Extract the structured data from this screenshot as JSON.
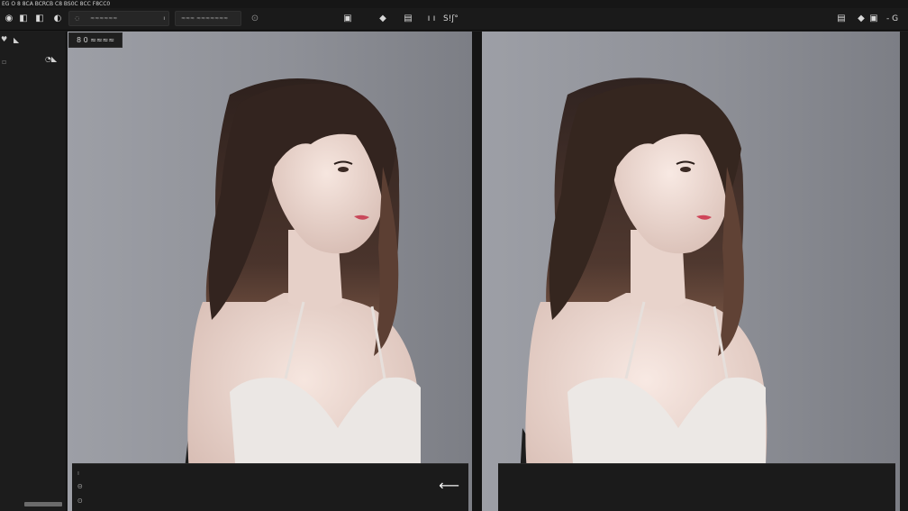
{
  "menubar": {
    "text": "EG O 8 8CA BCRCB C8 BS0C 8CC F8CC0"
  },
  "toolbar": {
    "left_icons": [
      "◉",
      "◧",
      "◧",
      "◐",
      "◎"
    ],
    "field_1": {
      "prefix": "◌",
      "value": "≈≈≈≈≈≈",
      "caret": "ı"
    },
    "field_2": {
      "value": "≈≈≈ ≈≈≈≈≈≈≈"
    },
    "settings_glyph": "⊙",
    "center_icons": [
      "▣",
      "◆",
      "▤",
      "ı ı",
      "S!ʃ°"
    ],
    "right_icons": [
      "▤",
      "◆",
      "▣",
      "- G"
    ]
  },
  "sidebar": {
    "icons": [
      "♥",
      "◣",
      "▫",
      "◔◣"
    ]
  },
  "panels": {
    "left": {
      "tag": "8 0 ≈≈≈≈"
    },
    "right": {
      "tag": ""
    }
  },
  "prompt": {
    "left_icons": [
      "ı",
      "Θ",
      "ʘ"
    ],
    "send_glyph": "⟵"
  },
  "colors": {
    "background": "#1e1e1e",
    "stage": "#8e9097",
    "hair": "#3b2a24",
    "skin": "#f0ddd6",
    "camisole": "#ebe7e4",
    "jacket": "#202020"
  }
}
